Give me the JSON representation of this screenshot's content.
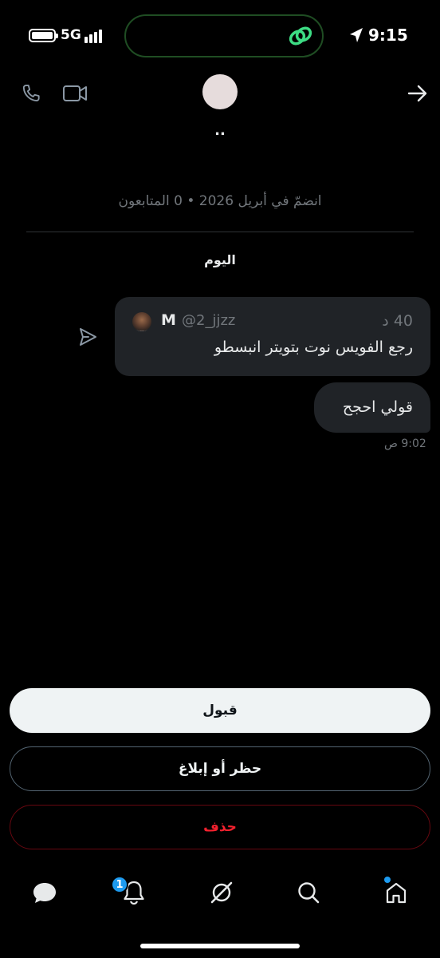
{
  "status_bar": {
    "network": "5G",
    "time": "9:15"
  },
  "header": {
    "name": "..",
    "icons": [
      "phone-icon",
      "video-icon",
      "back-arrow-icon"
    ]
  },
  "profile": {
    "joined_text": "انضمّ في أبريل 2026 • 0 المتابعون"
  },
  "conversation": {
    "day_label": "اليوم",
    "quote": {
      "name": "M",
      "handle": "@2_jjzz",
      "time": "40 د",
      "text": "رجع الفويس نوت بتويتر انبسطو"
    },
    "message": {
      "text": "قولي احجح",
      "time": "9:02 ص"
    }
  },
  "actions": {
    "accept_label": "قبول",
    "block_label": "حظر أو إبلاغ",
    "delete_label": "حذف"
  },
  "bottom_nav": {
    "notification_badge": "1",
    "items": [
      "messages-icon",
      "notifications-icon",
      "grok-icon",
      "search-icon",
      "home-icon"
    ]
  },
  "colors": {
    "background": "#000000",
    "bubble": "#202327",
    "accent": "#1d9bf0",
    "danger": "#f4212e",
    "muted": "#71767b"
  }
}
